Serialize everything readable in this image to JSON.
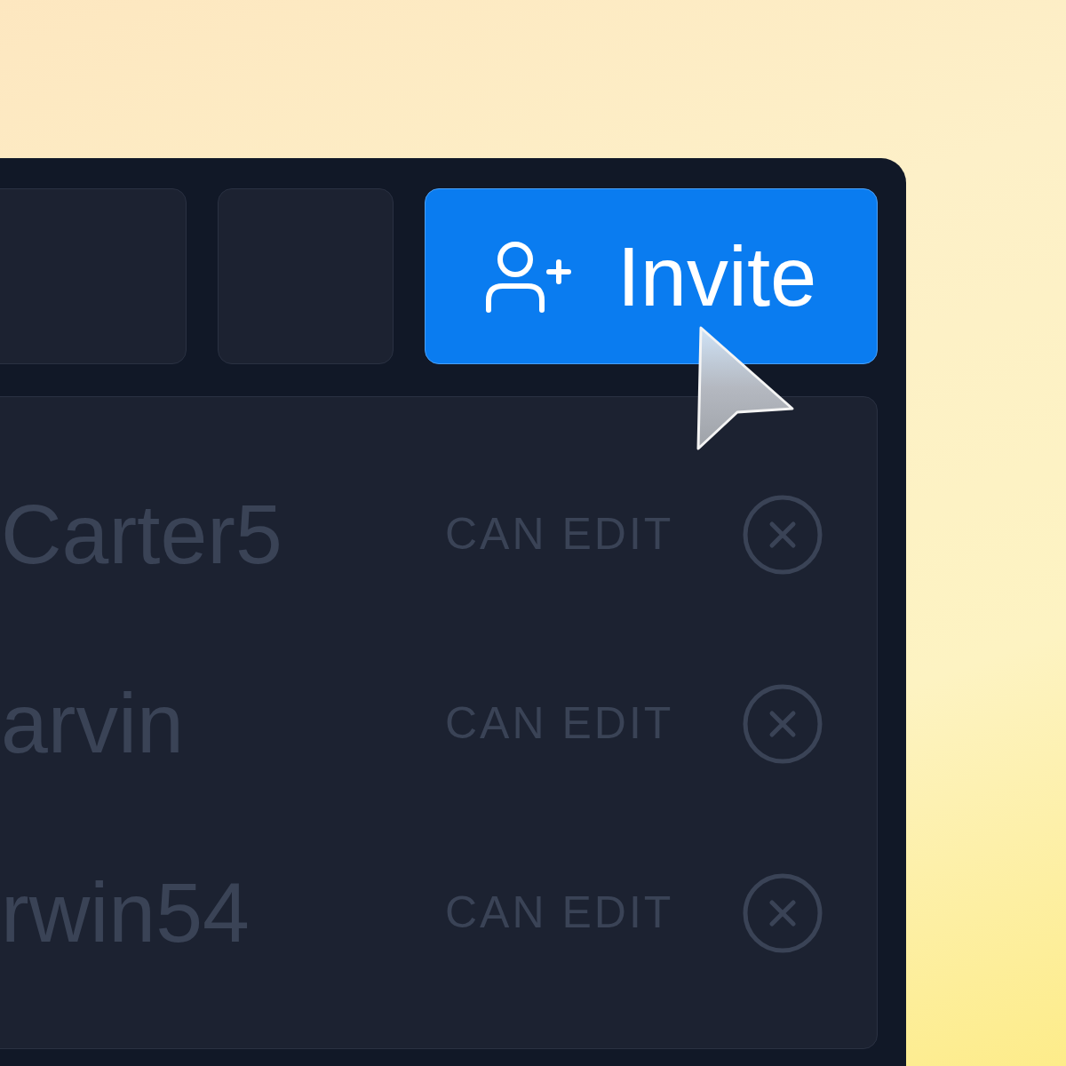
{
  "toolbar": {
    "buttons": [
      {
        "kind": "blank"
      },
      {
        "kind": "blank"
      },
      {
        "kind": "invite",
        "label": "Invite"
      }
    ]
  },
  "members": [
    {
      "name": "Carter5",
      "permission": "CAN EDIT"
    },
    {
      "name": "arvin",
      "permission": "CAN EDIT"
    },
    {
      "name": "rwin54",
      "permission": "CAN EDIT"
    }
  ]
}
